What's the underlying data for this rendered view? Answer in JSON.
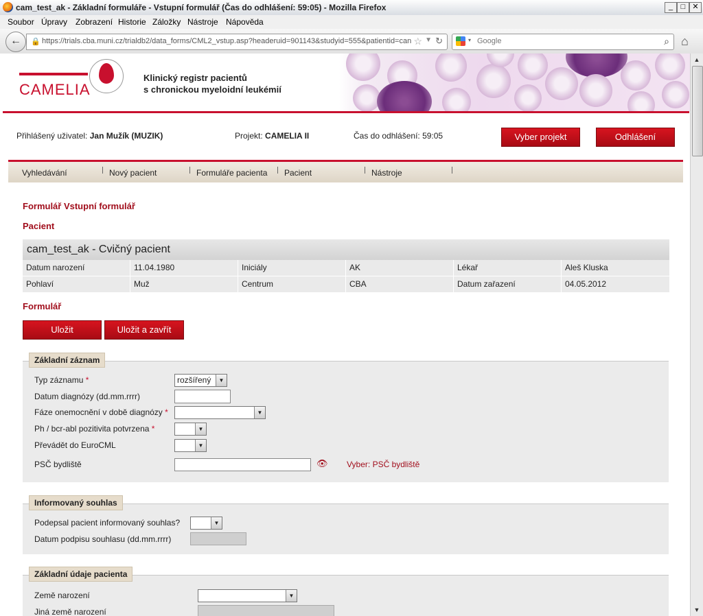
{
  "window": {
    "title": "cam_test_ak - Základní formuláře - Vstupní formulář (Čas do odhlášení: 59:05) - Mozilla Firefox"
  },
  "menu": [
    "Soubor",
    "Úpravy",
    "Zobrazení",
    "Historie",
    "Záložky",
    "Nástroje",
    "Nápověda"
  ],
  "browser": {
    "url": "https://trials.cba.muni.cz/trialdb2/data_forms/CML2_vstup.asp?headeruid=901143&studyid=555&patientid=can",
    "search_placeholder": "Google"
  },
  "header": {
    "logo": "CAMELIA",
    "registry_line1": "Klinický registr pacientů",
    "registry_line2": "s chronickou myeloidní leukémií"
  },
  "userbar": {
    "user_label": "Přihlášený uživatel:",
    "user_value": "Jan Mužík (MUZIK)",
    "project_label": "Projekt:",
    "project_value": "CAMELIA II",
    "timeout_label": "Čas do odhlášení:",
    "timeout_value": "59:05",
    "select_project": "Vyber projekt",
    "logout": "Odhlášení"
  },
  "nav": [
    "Vyhledávání",
    "Nový pacient",
    "Formuláře pacienta",
    "Pacient",
    "Nástroje"
  ],
  "form_title": "Formulář Vstupní formulář",
  "patient_heading": "Pacient",
  "patient": {
    "name": "cam_test_ak - Cvičný pacient",
    "rows": [
      [
        "Datum narození",
        "11.04.1980",
        "Iniciály",
        "AK",
        "Lékař",
        "Aleš Kluska"
      ],
      [
        "Pohlaví",
        "Muž",
        "Centrum",
        "CBA",
        "Datum zařazení",
        "04.05.2012"
      ]
    ]
  },
  "form_heading": "Formulář",
  "buttons": {
    "save": "Uložit",
    "save_close": "Uložit a zavřít"
  },
  "sections": {
    "basic": {
      "title": "Základní záznam",
      "type_label": "Typ záznamu",
      "type_value": "rozšířený",
      "diag_date_label": "Datum diagnózy (dd.mm.rrrr)",
      "phase_label": "Fáze onemocnění v době diagnózy",
      "ph_label": "Ph / bcr-abl pozitivita potvrzena",
      "eurocml_label": "Převádět do EuroCML",
      "psc_label": "PSČ bydliště",
      "psc_link": "Vyber: PSČ bydliště"
    },
    "consent": {
      "title": "Informovaný souhlas",
      "signed_label": "Podepsal pacient informovaný souhlas?",
      "date_label": "Datum podpisu souhlasu (dd.mm.rrrr)"
    },
    "patient_basic": {
      "title": "Základní údaje pacienta",
      "country_label": "Země narození",
      "other_country_label": "Jiná země narození"
    }
  },
  "required_mark": "*"
}
